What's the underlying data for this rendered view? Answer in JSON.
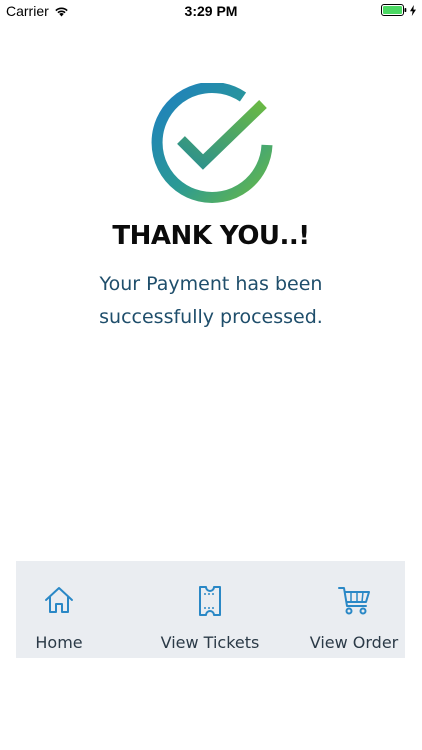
{
  "status_bar": {
    "carrier": "Carrier",
    "time": "3:29 PM",
    "battery_color": "#4cd964"
  },
  "success": {
    "icon": "check-circle-icon",
    "title": "THANK YOU..!",
    "message": "Your Payment has been successfully processed."
  },
  "colors": {
    "gradient_start": "#1e7fc1",
    "gradient_end": "#6ab944",
    "title": "#0b0b0b",
    "message": "#1f4e6b",
    "action_bar_bg": "#eaedf1",
    "action_icon": "#2a88c6"
  },
  "actions": [
    {
      "label": "Home",
      "icon": "home-icon"
    },
    {
      "label": "View Tickets",
      "icon": "ticket-icon"
    },
    {
      "label": "View Order",
      "icon": "cart-icon"
    }
  ]
}
